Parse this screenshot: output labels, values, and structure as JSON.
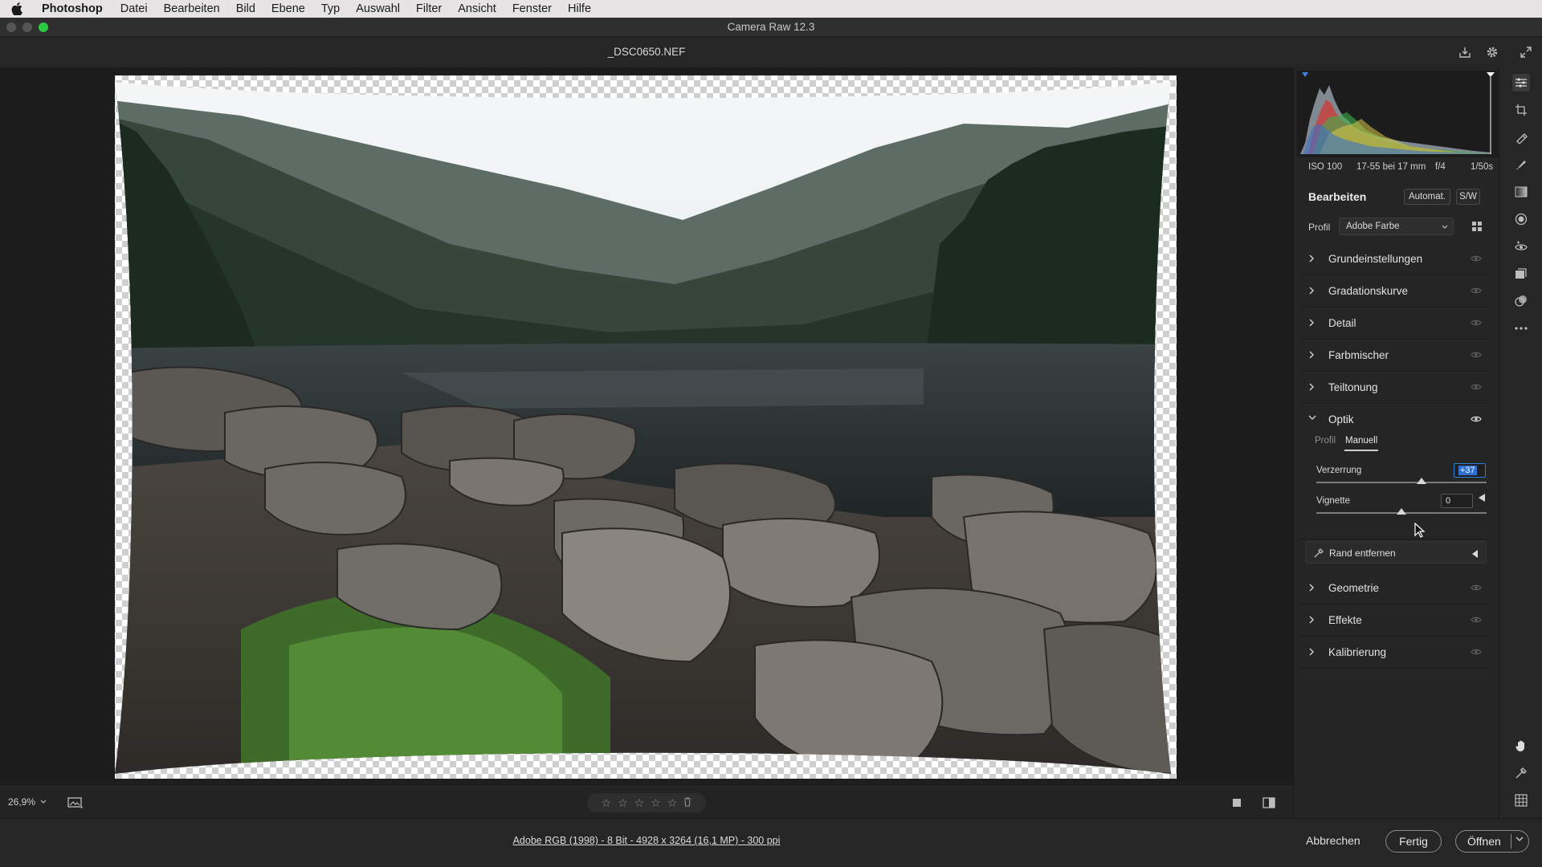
{
  "menubar": {
    "app_name": "Photoshop",
    "items": [
      "Datei",
      "Bearbeiten",
      "Bild",
      "Ebene",
      "Typ",
      "Auswahl",
      "Filter",
      "Ansicht",
      "Fenster",
      "Hilfe"
    ]
  },
  "window": {
    "title": "Camera Raw 12.3",
    "filename": "_DSC0650.NEF"
  },
  "histogram": {
    "iso": "ISO 100",
    "lens": "17-55 bei 17 mm",
    "aperture": "f/4",
    "shutter": "1/50s"
  },
  "edit": {
    "title": "Bearbeiten",
    "auto_label": "Automat.",
    "bw_label": "S/W",
    "profile_label": "Profil",
    "profile_value": "Adobe Farbe"
  },
  "sections_top": [
    {
      "label": "Grundeinstellungen"
    },
    {
      "label": "Gradationskurve"
    },
    {
      "label": "Detail"
    },
    {
      "label": "Farbmischer"
    },
    {
      "label": "Teiltonung"
    }
  ],
  "optik": {
    "title": "Optik",
    "tab_profil": "Profil",
    "tab_manuell": "Manuell",
    "distortion_label": "Verzerrung",
    "distortion_value": "+37",
    "distortion_level": 0.62,
    "vignette_label": "Vignette",
    "vignette_value": "0",
    "vignette_level": 0.5,
    "defringe_label": "Rand entfernen"
  },
  "sections_bottom": [
    {
      "label": "Geometrie"
    },
    {
      "label": "Effekte"
    },
    {
      "label": "Kalibrierung"
    }
  ],
  "canvas_bar": {
    "zoom": "26,9%"
  },
  "footer": {
    "info": "Adobe RGB (1998) - 8 Bit - 4928 x 3264 (16,1 MP) - 300 ppi",
    "cancel": "Abbrechen",
    "done": "Fertig",
    "open": "Öffnen"
  },
  "colors": {
    "accent": "#2f6fd0",
    "panel": "#252525",
    "green_light": "#2bc840"
  },
  "icons": [
    "apple-icon",
    "export-icon",
    "gear-icon",
    "fullscreen-icon",
    "chevron-right-icon",
    "chevron-down-icon",
    "eye-icon",
    "grid-icon",
    "star-icon",
    "trash-icon",
    "hand-icon",
    "eyedropper-icon"
  ]
}
